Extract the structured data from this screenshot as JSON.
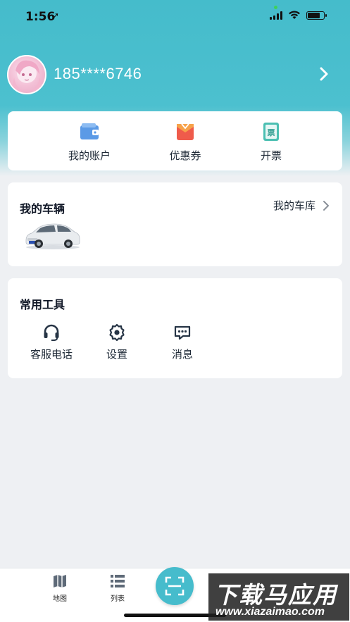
{
  "status_bar": {
    "time": "1:56",
    "location_glyph": "➚"
  },
  "profile": {
    "phone": "185****6746"
  },
  "quick_actions": [
    {
      "label": "我的账户",
      "icon": "wallet-icon",
      "color": "#5b9ae6"
    },
    {
      "label": "优惠券",
      "icon": "coupon-icon",
      "color": "#ef5b4b"
    },
    {
      "label": "开票",
      "icon": "invoice-icon",
      "color": "#4bbfb2",
      "icon_text": "票"
    }
  ],
  "vehicle": {
    "title": "我的车辆",
    "garage_label": "我的车库"
  },
  "tools": {
    "title": "常用工具",
    "items": [
      {
        "label": "客服电话",
        "icon": "headset-icon"
      },
      {
        "label": "设置",
        "icon": "settings-gear-icon"
      },
      {
        "label": "消息",
        "icon": "message-icon"
      }
    ]
  },
  "tabbar": {
    "items": [
      {
        "label": "地图",
        "icon": "map-icon"
      },
      {
        "label": "列表",
        "icon": "list-icon"
      }
    ]
  },
  "watermark": {
    "cn": "下载马应用",
    "en": "www.xiazaimao.com"
  },
  "colors": {
    "accent": "#46bccc",
    "card": "#ffffff",
    "background": "#eef0f3"
  }
}
